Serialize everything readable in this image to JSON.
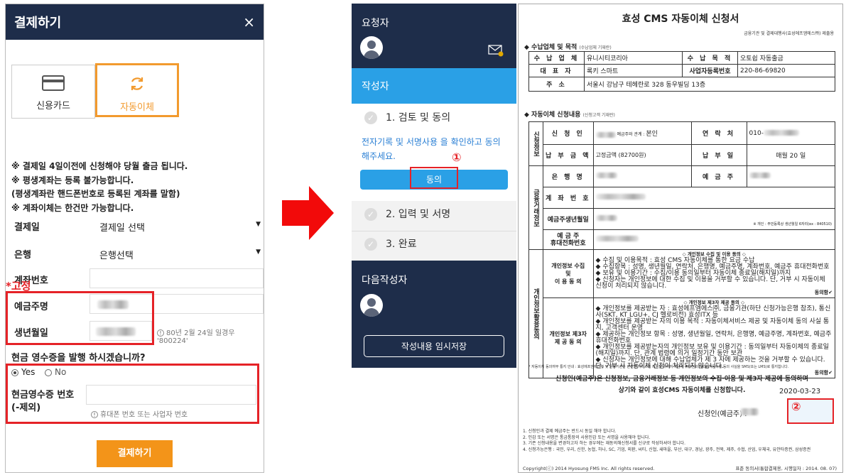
{
  "left": {
    "title": "결제하기",
    "close_icon": "×",
    "tabs": [
      {
        "label": "신용카드",
        "icon": "credit-card-icon"
      },
      {
        "label": "자동이체",
        "icon": "refresh-icon",
        "active": true
      }
    ],
    "notes": [
      "※ 결제일 4일이전에 신청해야 당월 출금 됩니다.",
      "※ 평생계좌는 등록 불가능합니다.",
      "(평생계좌란 핸드폰번호로 등록된 계좌를 말함)",
      "※ 계좌이체는 한건만 가능합니다."
    ],
    "fields": {
      "payday_label": "결제일",
      "payday_value": "결제일 선택",
      "bank_label": "은행",
      "bank_value": "은행선택",
      "account_label": "계좌번호",
      "holder_label": "예금주명",
      "birth_label": "생년월일",
      "birth_hint": "80년 2월 24일 일경우 '800224'"
    },
    "fixed_annotation": "*고정",
    "receipt_question": "현금 영수증을 발행 하시겠습니까?",
    "receipt_options": [
      {
        "label": "Yes",
        "selected": true
      },
      {
        "label": "No",
        "selected": false
      }
    ],
    "receipt_number_label_1": "현금영수증 번호",
    "receipt_number_label_2": "(-제외)",
    "receipt_hint": "휴대폰 번호 또는 사업자 번호",
    "pay_button": "결제하기",
    "colors": {
      "header": "#1e2d4a",
      "accent": "#f39419",
      "annotation": "#e52227"
    }
  },
  "mid": {
    "requester_heading": "요청자",
    "mail_icon": "mail-icon",
    "writer_heading": "작성자",
    "steps": [
      {
        "label": "1. 검토 및 동의"
      },
      {
        "label": "2. 입력 및 서명"
      },
      {
        "label": "3. 완료"
      }
    ],
    "agree_message": "전자기록 및 서명사용 을 확인하고 동의 해주세요.",
    "agree_button": "동의",
    "next_writer_heading": "다음작성자",
    "save_button": "작성내용 임시저장",
    "markers": {
      "one": "①",
      "two": "②"
    },
    "colors": {
      "panel": "#1e2d4a",
      "highlight": "#2aa0e6"
    }
  },
  "doc": {
    "title": "효성 CMS 자동이체 신청서",
    "subtitle": "금융기관 및 결제대행사(효성에프엠에스㈜) 제출용",
    "section1_heading": "◆ 수납업체 및 목적",
    "section1_note": "(수납업체 기재란)",
    "company": {
      "label_company": "수 납 업 체",
      "company_value": "유니시티코리아",
      "label_purpose": "수 납 목 적",
      "purpose_value": "오토쉽 자동출금",
      "label_ceo": "대 표 자",
      "ceo_value": "록키 스마트",
      "label_bizno": "사업자등록번호",
      "bizno_value": "220-86-69820",
      "label_address": "주 소",
      "address_value": "서울시 강남구 테헤란로 328 동우빌딩 13층"
    },
    "section2_heading": "◆ 자동이체 신청내용",
    "section2_note": "(신청고객 기재란)",
    "applicant": {
      "group_applicant": "신청정보",
      "label_name": "신 청 인",
      "name_note": "예금주와 관계 :",
      "relation_value": "본인",
      "label_contact": "연 락 처",
      "contact_value": "010-",
      "label_amount": "납 부 금 액",
      "amount_prefix": "고정금액 (",
      "amount_value": "82700",
      "amount_suffix": "원)",
      "label_payday": "납 부 일",
      "payday_value": "매월   20   일",
      "group_finance": "금융거래정보",
      "label_bank": "은 행 명",
      "label_holder": "예 금 주",
      "label_account": "계 좌 번 호",
      "label_birth": "예금주생년월일",
      "birth_note": "※ 개인 : 주민등록상 생년월일 6자리(ex : 840510)",
      "label_phone_1": "예 금 주",
      "label_phone_2": "휴대전화번호"
    },
    "privacy": {
      "group": "개인정보활용동의",
      "collect_label_1": "개인정보 수집",
      "collect_label_2": "및",
      "collect_label_3": "이 용 동 의",
      "collect_heading": "◇ 개인정보 수집 및 이용 동의 ◇",
      "collect_items": [
        "◆ 수집 및 이용목적 : 효성 CMS 자동이체를 통한 요금 수납",
        "◆ 수집항목 : 성명, 생년월일, 연락처, 은행명, 예금주명, 계좌번호, 예금주 휴대전화번호",
        "◆ 보유 및 이용기간 : 수집/이용 동의일부터 자동이체 종료일(해지일)까지",
        "◆ 신청자는 개인정보에 대한 수집 및 이용을 거부할 수 있습니다. 단, 거부 시 자동이체 신청이 처리되지 않습니다."
      ],
      "collect_agree": "동의함",
      "provide_label_1": "개인정보 제3자",
      "provide_label_2": "제 공 동 의",
      "provide_heading": "◇ 개인정보 제3자 제공 동의 ◇",
      "provide_items": [
        "◆ 개인정보를 제공받는 자 : 효성에프엠에스㈜, 금융기관(하단 신청가능은행 참조), 통신사(SKT, KT LGU+, CJ 헬로비전) 효성ITX 등",
        "◆ 개인정보를 제공받는 자의 이용 목적 : 자동이체서비스 제공 및 자동이체 동의 사실 통지, 고객센터 운영",
        "◆ 제공하는 개인정보 항목 : 성명, 생년월일, 연락처, 은행명, 예금주명, 계좌번호, 예금주 휴대전화번호",
        "◆ 개인정보를 제공받는자의 개인정보 보유 및 이용기간 : 동의일부터 자동이체의 종료일(해지일)까지. 단, 관계 법령에 의거 일정기간 동안 보관",
        "◆ 신청자는 개인정보에 대해 수납업체가 제 3 자에 제공하는 것을 거부할 수 있습니다. 단, 거부 시 자동이체 신청이 처리되지 않습니다."
      ],
      "provide_agree": "동의함"
    },
    "notice_small": "* 자동이체 동의여부 통지 안내 : 효성에프엠에스㈜ 및 금융기관은 안전한 서비스의 제공을 위하여 예금주 휴대전화번호로 자동이체 동의 사실을 SMS(또는 LMS)로 통지합니다.",
    "consent_line_1": "신청인(예금주)은 신청정보, 금융거래정보 등 개인정보의 수집·이용 및 제3자 제공에 동의하며",
    "consent_line_2": "상기와 같이 효성CMS 자동이체를 신청합니다.",
    "date": "2020-03-23",
    "signer_label": "신청인(예금주) :",
    "footnotes": [
      "1. 신청인과 결제 예금주는 반드시 동일 해야 합니다.",
      "2. 인감 또는 서명은 통금통장의 사용인감 또는 서명을 사용해야 합니다.",
      "3. 기존 신청내용을 변경하고자 하는 경우에는 재동의해신청서를 신규로 작성하셔야 합니다.",
      "4. 신청가능은행 : 국민, 우리, 신한, 농협, 하나, SC, 기업, 외환, 씨티, 신협, 새마을, 부산, 대구, 경남, 광주, 전북, 제주, 수협, 산업, 우체국, 유안타증권, 삼성증권"
    ],
    "copyright": "Copyright(ⓒ) 2014 Hyosung FMS Inc. All rights reserved.",
    "form_version": "표준 동의서(통합결제용, 시행일자 : 2014. 08. 07)"
  }
}
